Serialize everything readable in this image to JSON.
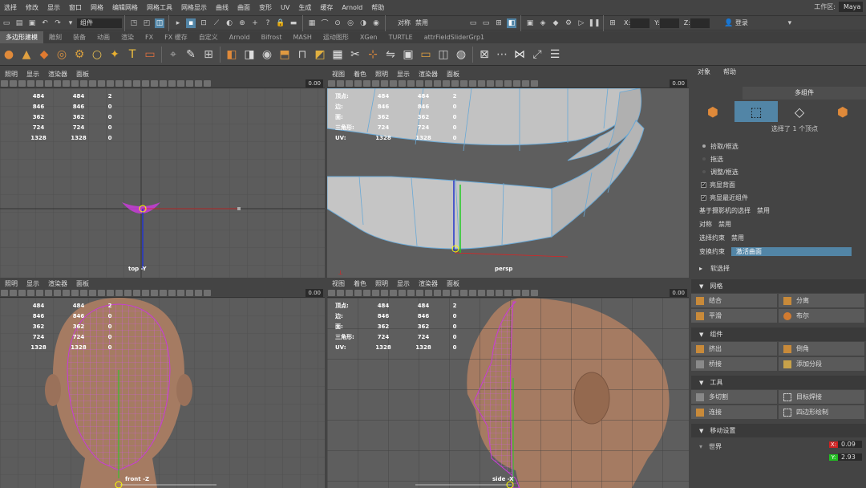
{
  "menubar": {
    "items": [
      "选择",
      "修改",
      "显示",
      "窗口",
      "网格",
      "编辑网格",
      "网格工具",
      "网格显示",
      "曲线",
      "曲面",
      "变形",
      "UV",
      "生成",
      "缓存",
      "Arnold",
      "帮助"
    ],
    "workspace_label": "工作区:",
    "workspace_value": "Maya"
  },
  "statusbar": {
    "mode": "组件",
    "symmetry_label": "对称",
    "symmetry_value": "禁用",
    "x_label": "X:",
    "y_label": "Y:",
    "z_label": "Z:",
    "login": "登录"
  },
  "shelf_tabs": [
    "多边形建模",
    "雕刻",
    "装备",
    "动画",
    "渲染",
    "FX",
    "FX 缓存",
    "自定义",
    "Arnold",
    "Bifrost",
    "MASH",
    "运动图形",
    "XGen",
    "TURTLE",
    "attrFieldSliderGrp1"
  ],
  "shelf_icons": [
    "sphere-icon",
    "cone-icon",
    "pyramid-icon",
    "torus-icon",
    "gear-icon",
    "ring-icon",
    "star-icon",
    "text-icon",
    "svg-icon",
    "camera-icon",
    "sculpt-icon",
    "uv-icon",
    "combine-icon",
    "separate-icon",
    "smooth-icon",
    "extrude-icon",
    "bridge-icon",
    "bevel-icon",
    "fill-icon",
    "multicut-icon",
    "target-weld-icon",
    "mirror-icon",
    "cube-icon",
    "planar-icon",
    "cylindrical-icon",
    "spherical-icon",
    "automatic-icon",
    "cut-icon",
    "sew-icon",
    "unfold-icon",
    "layout-icon"
  ],
  "viewports": {
    "menu_items": [
      "照明",
      "显示",
      "渲染器",
      "面板"
    ],
    "menu_items_persp": [
      "视图",
      "着色",
      "照明",
      "显示",
      "渲染器",
      "面板"
    ],
    "num": "0.00",
    "hud_labels": [
      "顶点:",
      "边:",
      "面:",
      "三角形:",
      "UV:"
    ],
    "hud_rows": [
      {
        "v1": "484",
        "v2": "484",
        "v3": "2"
      },
      {
        "v1": "846",
        "v2": "846",
        "v3": "0"
      },
      {
        "v1": "362",
        "v2": "362",
        "v3": "0"
      },
      {
        "v1": "724",
        "v2": "724",
        "v3": "0"
      },
      {
        "v1": "1328",
        "v2": "1328",
        "v3": "0"
      }
    ],
    "top_label": "top -Y",
    "persp_label": "persp",
    "front_label": "front -Z",
    "side_label": "side -X"
  },
  "right_panel": {
    "top_tabs": [
      "对象",
      "帮助"
    ],
    "component_title": "多组件",
    "selection_info": "选择了 1 个顶点",
    "options": [
      "拾取/框选",
      "拖选",
      "调整/框选"
    ],
    "check_options": [
      "亮显背面",
      "亮显最近组件"
    ],
    "camera_select_label": "基于摄影机的选择",
    "camera_select_value": "禁用",
    "symmetry_label": "对称",
    "symmetry_value": "禁用",
    "constraint_label": "选择约束",
    "constraint_value": "禁用",
    "transform_label": "变换约束",
    "transform_value": "激活曲面",
    "soft_select": "软选择",
    "mesh_section": "网格",
    "mesh_buttons": [
      "结合",
      "分离",
      "平滑",
      "布尔"
    ],
    "component_section": "组件",
    "component_buttons": [
      "挤出",
      "倒角",
      "桥接",
      "添加分段"
    ],
    "tool_section": "工具",
    "tool_buttons": [
      "多切割",
      "目标焊接",
      "连接",
      "四边形绘制"
    ],
    "move_section": "移动设置",
    "world_label": "世界",
    "x_value": "0.09",
    "y_value": "2.93"
  }
}
